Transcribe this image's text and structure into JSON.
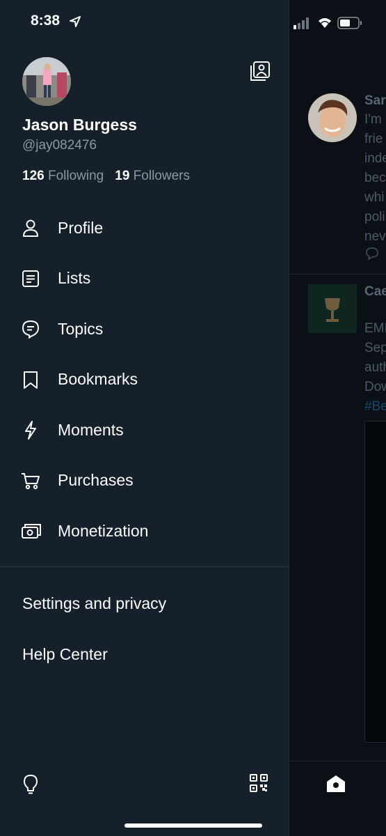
{
  "status_bar": {
    "time": "8:38"
  },
  "profile": {
    "name": "Jason Burgess",
    "handle": "@jay082476",
    "following_count": "126",
    "following_label": "Following",
    "followers_count": "19",
    "followers_label": "Followers"
  },
  "menu": [
    {
      "label": "Profile",
      "icon": "person-icon"
    },
    {
      "label": "Lists",
      "icon": "list-icon"
    },
    {
      "label": "Topics",
      "icon": "topics-icon"
    },
    {
      "label": "Bookmarks",
      "icon": "bookmark-icon"
    },
    {
      "label": "Moments",
      "icon": "lightning-icon"
    },
    {
      "label": "Purchases",
      "icon": "cart-icon"
    },
    {
      "label": "Monetization",
      "icon": "money-icon"
    }
  ],
  "links": {
    "settings": "Settings and privacy",
    "help": "Help Center"
  },
  "background_feed": {
    "tweet1_name": "Sar",
    "tweet1_lines": [
      "I'm",
      "frie",
      "inde",
      "bec",
      "whi",
      "poli",
      "nev"
    ],
    "tweet2_name": "Cae",
    "tweet2_lines": [
      "EMI",
      "Sep",
      "auth",
      "Dow"
    ],
    "tweet2_hashtag": "#Be"
  },
  "colors": {
    "background": "#15202b",
    "secondary_text": "#8899a6",
    "accent": "#1da1f2"
  }
}
